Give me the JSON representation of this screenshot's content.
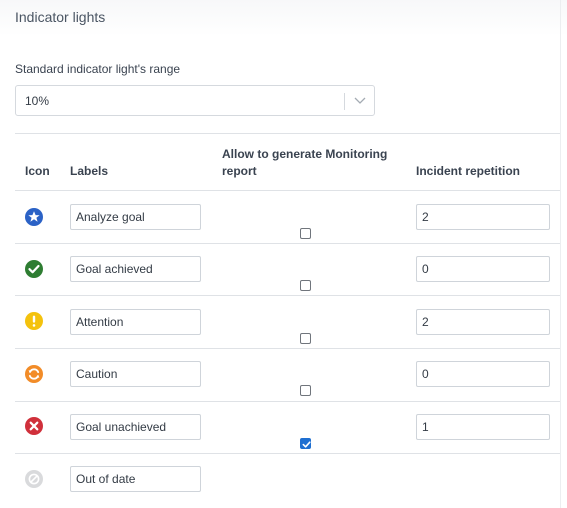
{
  "section": {
    "title": "Indicator lights"
  },
  "range": {
    "label": "Standard indicator light's range",
    "value": "10%"
  },
  "table": {
    "headers": {
      "icon": "Icon",
      "labels": "Labels",
      "allow": "Allow to generate Monitoring report",
      "repetition": "Incident repetition"
    },
    "rows": [
      {
        "icon": "star-circle-icon",
        "color": "#2b62c6",
        "label": "Analyze goal",
        "allow": false,
        "repetition": "2"
      },
      {
        "icon": "check-circle-icon",
        "color": "#2e7d32",
        "label": "Goal achieved",
        "allow": false,
        "repetition": "0"
      },
      {
        "icon": "exclamation-circle-icon",
        "color": "#f4c20d",
        "label": "Attention",
        "allow": false,
        "repetition": "2"
      },
      {
        "icon": "refresh-circle-icon",
        "color": "#f28c28",
        "label": "Caution",
        "allow": false,
        "repetition": "0"
      },
      {
        "icon": "x-circle-icon",
        "color": "#d0303b",
        "label": "Goal unachieved",
        "allow": true,
        "repetition": "1"
      },
      {
        "icon": "ban-circle-icon",
        "color": "#d9dadc",
        "label": "Out of date"
      }
    ]
  }
}
